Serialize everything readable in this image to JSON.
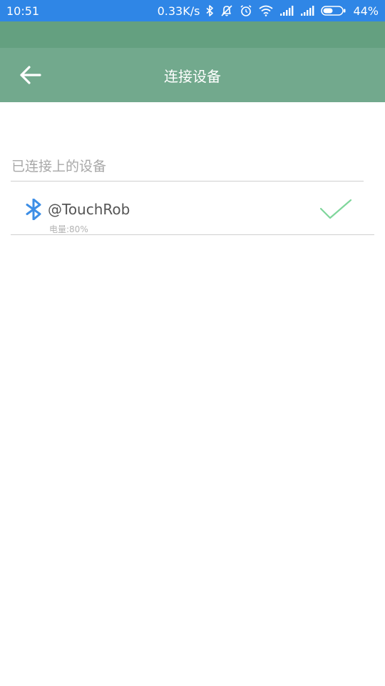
{
  "status_bar": {
    "time": "10:51",
    "net_speed": "0.33K/s",
    "battery": "44%",
    "bg_color": "#2f86e6",
    "icons": [
      "bluetooth-icon",
      "mute-icon",
      "alarm-icon",
      "wifi-icon",
      "signal-icon",
      "signal-icon",
      "battery-icon"
    ]
  },
  "toolbar": {
    "title": "连接设备",
    "back_icon": "arrow-left-icon",
    "bg_color": "#72a98d"
  },
  "section": {
    "title": "已连接上的设备"
  },
  "devices": [
    {
      "name": "@TouchRob",
      "battery_text": "电量:80%",
      "icon": "bluetooth-icon",
      "status_icon": "check-icon",
      "connected": true
    }
  ],
  "colors": {
    "bluetooth_icon": "#3d8ee6",
    "check_icon": "#7fd69b"
  }
}
